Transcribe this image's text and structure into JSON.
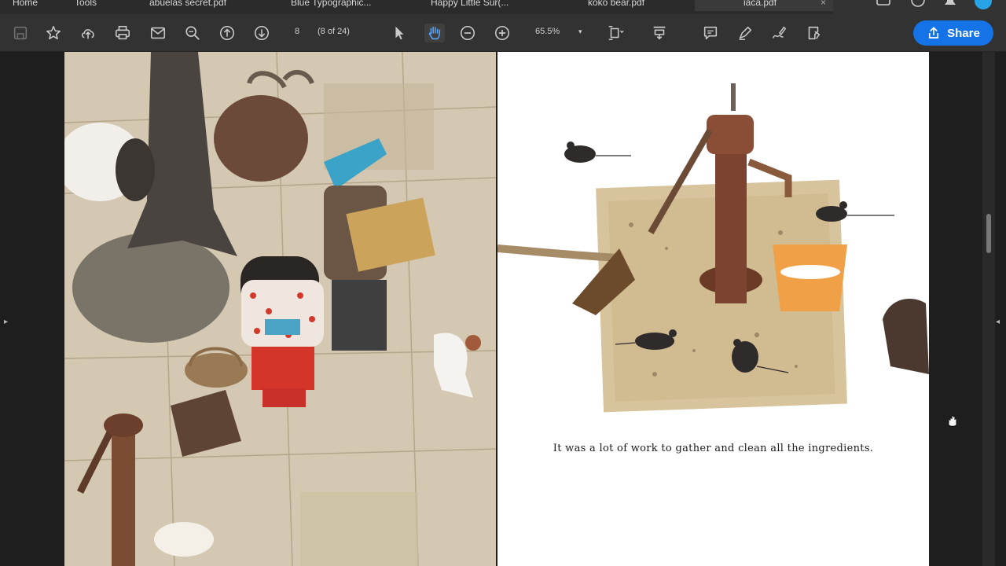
{
  "tabs": [
    {
      "label": "Home"
    },
    {
      "label": "Tools"
    },
    {
      "label": "abuelas secret.pdf"
    },
    {
      "label": "Blue Typographic..."
    },
    {
      "label": "Happy Little Sur(..."
    },
    {
      "label": "koko bear.pdf"
    },
    {
      "label": "iaca.pdf"
    }
  ],
  "toolbar": {
    "page_number": "8",
    "page_total": "(8 of 24)",
    "zoom": "65.5%",
    "share_label": "Share"
  },
  "page": {
    "caption": "It was a lot of work to gather and clean all the ingredients."
  },
  "colors": {
    "accent": "#1473e6",
    "toolbar": "#323232",
    "background": "#1e1e1e"
  }
}
